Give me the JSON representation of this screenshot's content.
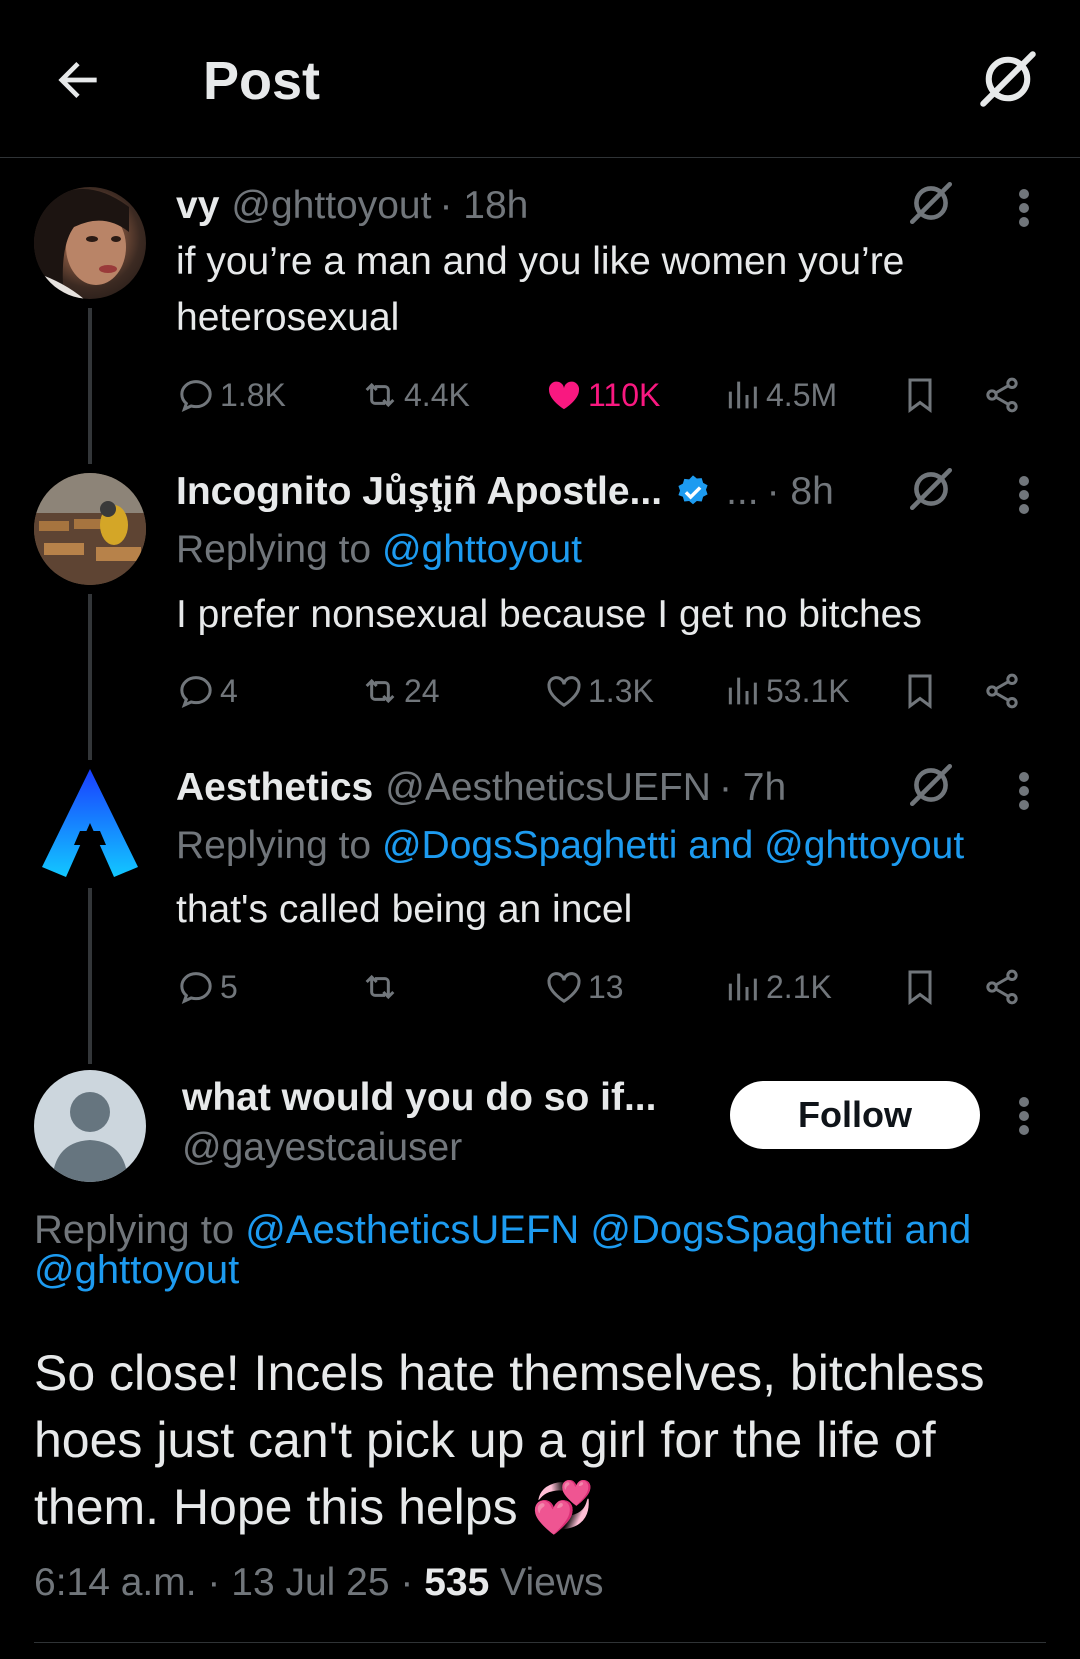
{
  "header": {
    "title": "Post",
    "back_icon": "arrow-left-icon",
    "grok_icon": "grok-icon"
  },
  "tweets": [
    {
      "name": "vy",
      "handle": "@ghttoyout",
      "time": "· 18h",
      "text": "if you’re a man and you like women you’re heterosexual",
      "replies": "1.8K",
      "reposts": "4.4K",
      "likes": "110K",
      "views": "4.5M"
    },
    {
      "name": "Incognito Jůşţįñ Apostle...",
      "handle": "...",
      "time": "· 8h",
      "reply_prefix": "Replying to ",
      "reply_mentions": "@ghttoyout",
      "text": "I prefer nonsexual because I get no bitches",
      "replies": "4",
      "reposts": "24",
      "likes": "1.3K",
      "views": "53.1K"
    },
    {
      "name": "Aesthetics",
      "handle": "@AestheticsUEFN",
      "time": "· 7h",
      "reply_prefix": "Replying to ",
      "reply_mentions": "@DogsSpaghetti and @ghttoyout",
      "text": "that's called being an incel",
      "replies": "5",
      "reposts": "",
      "likes": "13",
      "views": "2.1K"
    }
  ],
  "main": {
    "name": "what would you do so if...",
    "handle": "@gayestcaiuser",
    "follow_label": "Follow",
    "reply_prefix": "Replying to ",
    "reply_mentions": "@AestheticsUEFN @DogsSpaghetti and @ghttoyout",
    "text": "So close! Incels hate themselves, bitchless hoes just can't pick up a girl for the life of them. Hope this helps",
    "emoji": "💞",
    "time": "6:14 a.m.",
    "date": "13 Jul 25",
    "views_count": "535",
    "views_label": "Views",
    "sep": " · "
  },
  "colors": {
    "accent": "#1d9bf0",
    "like": "#f91880",
    "muted": "#71767b",
    "background": "#000000"
  }
}
